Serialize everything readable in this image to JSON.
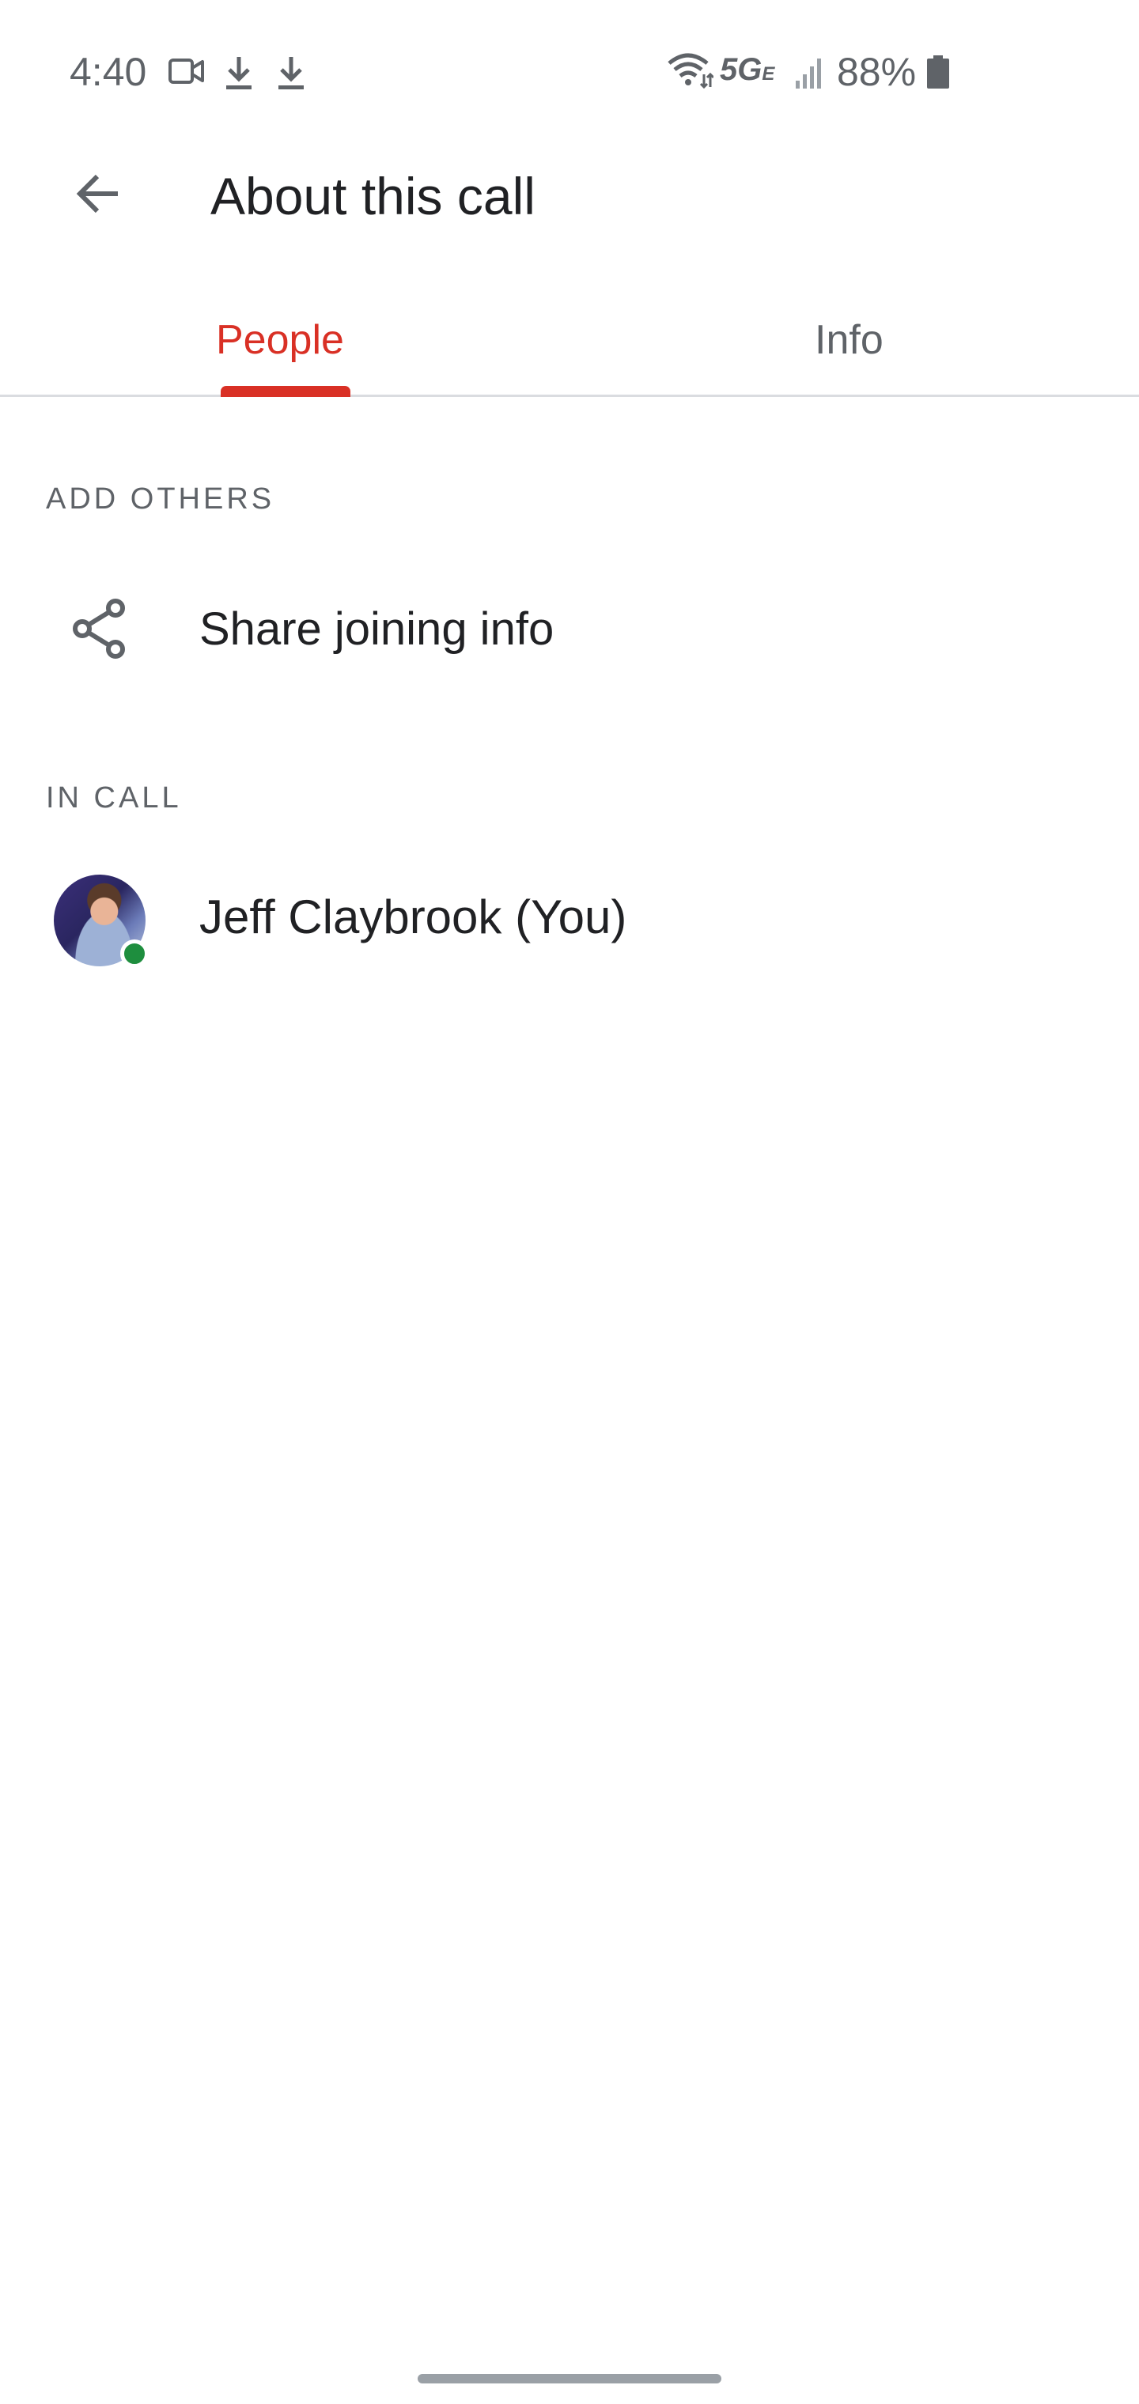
{
  "status_bar": {
    "time": "4:40",
    "network": "5G",
    "network_sub": "E",
    "battery": "88%",
    "icons": [
      "video-camera-icon",
      "download-icon",
      "download-icon",
      "wifi-icon",
      "signal-icon",
      "battery-icon"
    ]
  },
  "app_bar": {
    "title": "About this call",
    "back_icon": "arrow-back-icon"
  },
  "tabs": [
    {
      "label": "People",
      "selected": true
    },
    {
      "label": "Info",
      "selected": false
    }
  ],
  "add_others": {
    "header": "ADD OTHERS",
    "share": {
      "label": "Share joining info",
      "icon": "share-icon"
    }
  },
  "in_call": {
    "header": "IN CALL",
    "participants": [
      {
        "name": "Jeff Claybrook (You)",
        "status": "online"
      }
    ]
  },
  "colors": {
    "accent": "#d93025",
    "online": "#1e8e3e",
    "secondary_text": "#5f6368"
  }
}
